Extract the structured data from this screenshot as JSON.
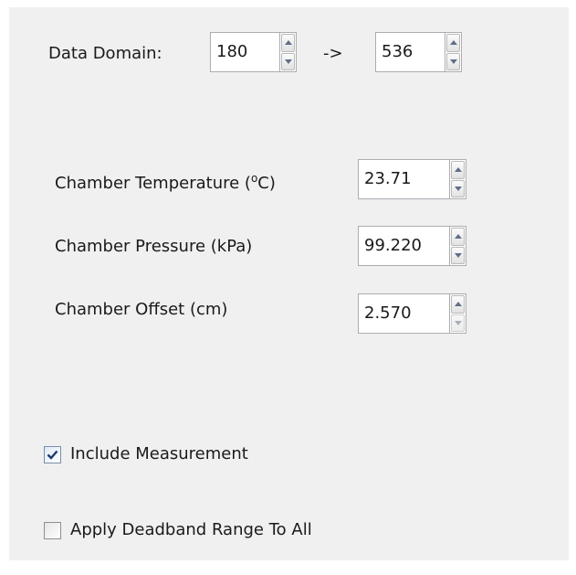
{
  "data_domain": {
    "label": "Data Domain:",
    "start_value": "180",
    "arrow": "->",
    "end_value": "536"
  },
  "chamber": {
    "temperature": {
      "label_prefix": "Chamber Temperature (",
      "label_unit_sup": "o",
      "label_suffix": "C)",
      "value": "23.71"
    },
    "pressure": {
      "label": "Chamber Pressure (kPa)",
      "value": "99.220"
    },
    "offset": {
      "label": "Chamber Offset (cm)",
      "value": "2.570"
    }
  },
  "options": {
    "include_measurement": {
      "label": "Include Measurement",
      "checked": true
    },
    "apply_deadband": {
      "label": "Apply Deadband Range To All",
      "checked": false
    }
  },
  "colors": {
    "panel_background": "#f0f0f0",
    "field_border": "#abadb3",
    "check_mark": "#1c3a6e"
  }
}
